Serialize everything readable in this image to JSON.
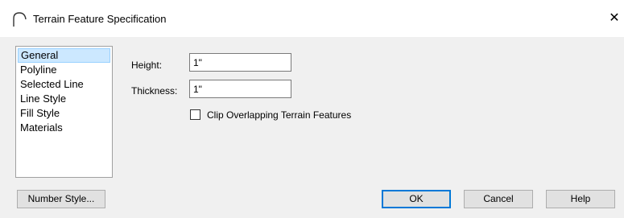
{
  "window": {
    "title": "Terrain Feature Specification",
    "close_glyph": "✕"
  },
  "nav": {
    "items": [
      {
        "label": "General",
        "selected": true
      },
      {
        "label": "Polyline",
        "selected": false
      },
      {
        "label": "Selected Line",
        "selected": false
      },
      {
        "label": "Line Style",
        "selected": false
      },
      {
        "label": "Fill Style",
        "selected": false
      },
      {
        "label": "Materials",
        "selected": false
      }
    ]
  },
  "general": {
    "height_label": "Height:",
    "height_value": "1\"",
    "thickness_label": "Thickness:",
    "thickness_value": "1\"",
    "clip_label": "Clip Overlapping Terrain Features",
    "clip_checked": false
  },
  "buttons": {
    "number_style": "Number Style...",
    "ok": "OK",
    "cancel": "Cancel",
    "help": "Help"
  },
  "icons": {
    "title_icon": "terrain-arch-icon",
    "close_icon": "close-icon"
  },
  "colors": {
    "selection_bg": "#cce8ff",
    "selection_border": "#99d1ff",
    "default_button_border": "#0078d7",
    "client_bg": "#f0f0f0"
  }
}
